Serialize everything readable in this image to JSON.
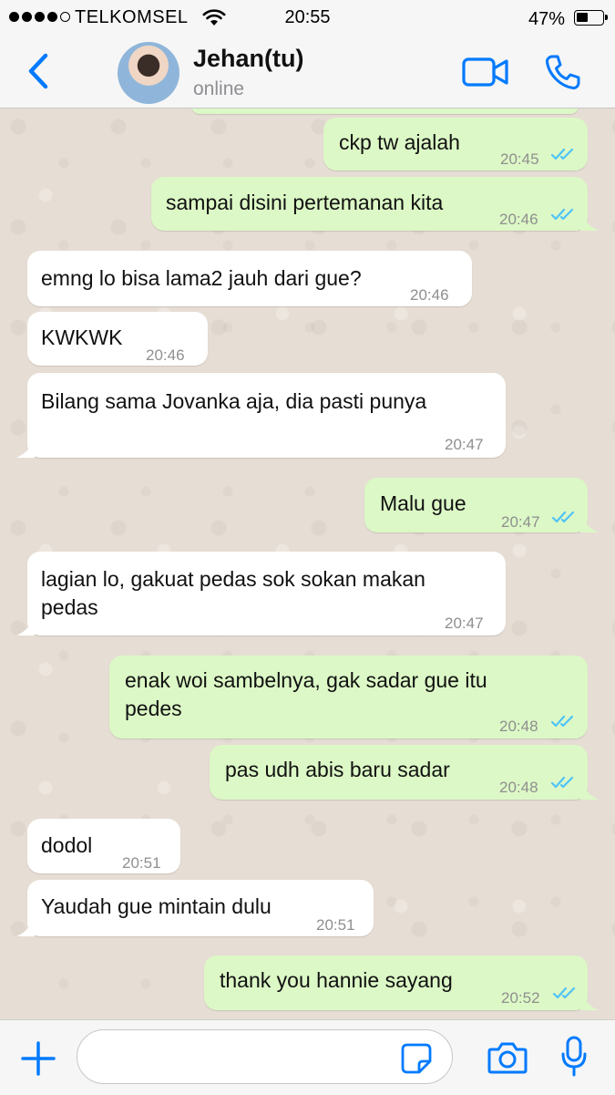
{
  "status_bar": {
    "carrier": "TELKOMSEL",
    "time": "20:55",
    "battery_percent": "47%",
    "battery_level": 0.47,
    "signal_bars_filled": 4,
    "signal_bars_total": 5
  },
  "header": {
    "contact_name": "Jehan(tu)",
    "contact_status": "online",
    "icons": [
      "back-chevron-icon",
      "avatar",
      "video-camera-icon",
      "phone-icon"
    ]
  },
  "messages": [
    {
      "dir": "out",
      "text": "ckp tw ajalah",
      "time": "20:45",
      "read": true
    },
    {
      "dir": "out",
      "text": "sampai disini pertemanan kita",
      "time": "20:46",
      "read": true
    },
    {
      "dir": "in",
      "text": "emng lo bisa lama2 jauh dari gue?",
      "time": "20:46"
    },
    {
      "dir": "in",
      "text": "KWKWK",
      "time": "20:46"
    },
    {
      "dir": "in",
      "text": "Bilang sama Jovanka aja, dia pasti punya",
      "time": "20:47"
    },
    {
      "dir": "out",
      "text": "Malu gue",
      "time": "20:47",
      "read": true
    },
    {
      "dir": "in",
      "text_line1": "lagian lo, gakuat pedas sok sokan makan",
      "text_line2": "pedas",
      "time": "20:47"
    },
    {
      "dir": "out",
      "text_line1": "enak woi sambelnya, gak sadar gue itu",
      "text_line2": "pedes",
      "time": "20:48",
      "read": true
    },
    {
      "dir": "out",
      "text": "pas udh abis baru sadar",
      "time": "20:48",
      "read": true
    },
    {
      "dir": "in",
      "text": "dodol",
      "time": "20:51"
    },
    {
      "dir": "in",
      "text": "Yaudah gue mintain dulu",
      "time": "20:51"
    },
    {
      "dir": "out",
      "text": "thank you hannie sayang",
      "time": "20:52",
      "read": true
    }
  ],
  "input_bar": {
    "icons": [
      "plus-icon",
      "sticker-icon",
      "camera-icon",
      "microphone-icon"
    ]
  },
  "colors": {
    "accent": "#007aff",
    "outgoing_bubble": "#dcf8c6",
    "incoming_bubble": "#ffffff",
    "read_ticks": "#4fc3f7",
    "chat_background": "#e6ddd4"
  }
}
